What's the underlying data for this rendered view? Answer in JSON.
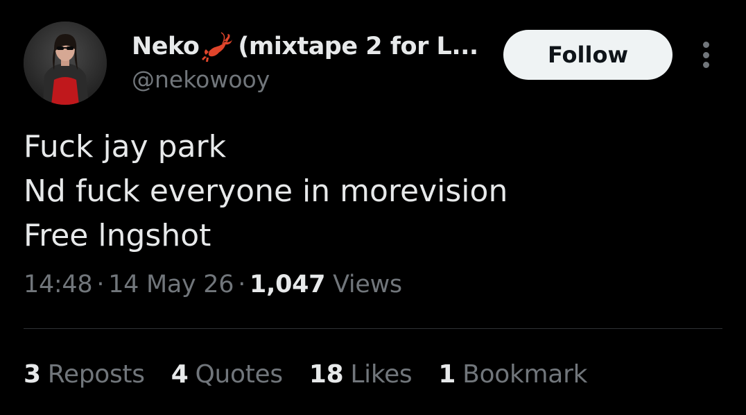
{
  "author": {
    "display_name_prefix": "Neko",
    "display_name_emoji": "lobster-icon",
    "display_name_suffix": "(mixtape 2 for L...",
    "handle": "@nekowooy",
    "avatar": "profile-photo"
  },
  "actions": {
    "follow_label": "Follow",
    "more_icon": "more-vertical-icon"
  },
  "tweet": {
    "lines": [
      "Fuck jay park",
      "Nd fuck everyone in morevision",
      "Free lngshot"
    ]
  },
  "meta": {
    "time": "14:48",
    "separator": "·",
    "date": "14 May 26",
    "views_count": "1,047",
    "views_label": "Views"
  },
  "stats": [
    {
      "count": "3",
      "label": "Reposts"
    },
    {
      "count": "4",
      "label": "Quotes"
    },
    {
      "count": "18",
      "label": "Likes"
    },
    {
      "count": "1",
      "label": "Bookmark"
    }
  ],
  "colors": {
    "background": "#000000",
    "primary_text": "#e7e9ea",
    "secondary_text": "#71767b",
    "follow_button_bg": "#eff3f4",
    "follow_button_text": "#0f1419",
    "divider": "#2f3336",
    "lobster": "#e0452b"
  }
}
